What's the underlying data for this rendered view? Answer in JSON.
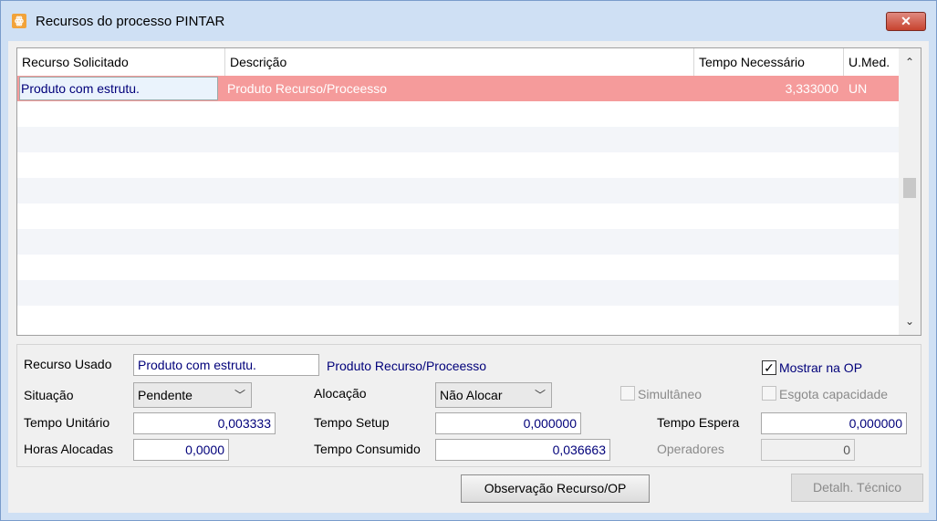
{
  "window": {
    "title": "Recursos do processo PINTAR",
    "close_label": "✕",
    "app_icon": "app-logo-icon"
  },
  "grid": {
    "columns": [
      "Recurso Solicitado",
      "Descrição",
      "Tempo Necessário",
      "U.Med."
    ],
    "rows": [
      {
        "recurso": "Produto com estrutu.",
        "descricao": "Produto Recurso/Proceesso",
        "tempo": "3,333000",
        "umed": "UN"
      }
    ],
    "scroll_up": "⌃",
    "scroll_down": "⌄"
  },
  "form": {
    "recurso_usado_label": "Recurso Usado",
    "recurso_usado_value": "Produto com estrutu.",
    "recurso_usado_desc": "Produto Recurso/Proceesso",
    "mostrar_na_op_label": "Mostrar na OP",
    "mostrar_na_op_checked": true,
    "situacao_label": "Situação",
    "situacao_value": "Pendente",
    "alocacao_label": "Alocação",
    "alocacao_value": "Não Alocar",
    "simultaneo_label": "Simultâneo",
    "esgota_label": "Esgota capacidade",
    "tempo_unitario_label": "Tempo Unitário",
    "tempo_unitario_value": "0,003333",
    "tempo_setup_label": "Tempo Setup",
    "tempo_setup_value": "0,000000",
    "tempo_espera_label": "Tempo Espera",
    "tempo_espera_value": "0,000000",
    "horas_alocadas_label": "Horas Alocadas",
    "horas_alocadas_value": "0,0000",
    "tempo_consumido_label": "Tempo Consumido",
    "tempo_consumido_value": "0,036663",
    "operadores_label": "Operadores",
    "operadores_value": "0"
  },
  "buttons": {
    "observacao": "Observação Recurso/OP",
    "detalh_tecnico": "Detalh. Técnico"
  },
  "colors": {
    "selected_row": "#f59b9b",
    "title_bg": "#cfe0f4",
    "close_button": "#c7432f"
  }
}
